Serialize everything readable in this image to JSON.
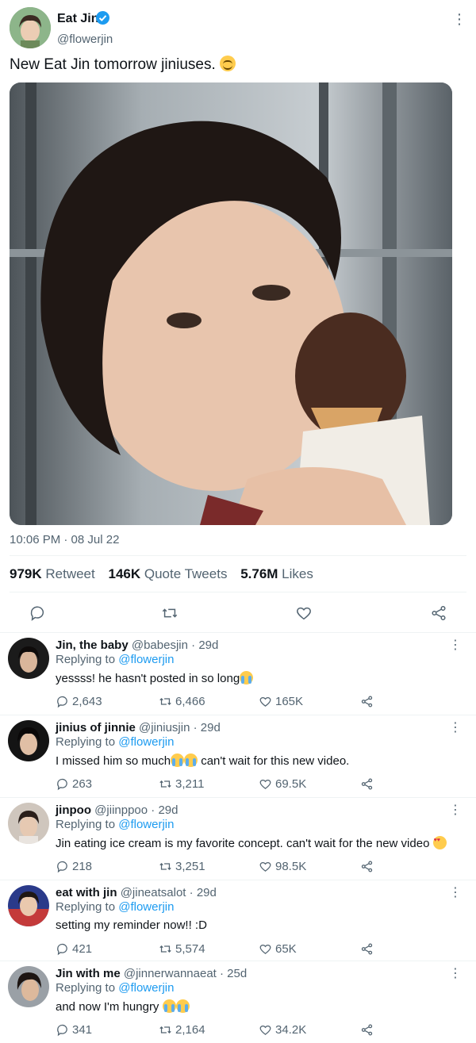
{
  "tweet": {
    "author_name": "Eat Jin",
    "author_handle": "@flowerjin",
    "verified_icon": "verified-badge-icon",
    "text": "New Eat Jin tomorrow jiniuses.",
    "text_emoji": "smiling-face-emoji",
    "media_description_icon": "photo",
    "timestamp": "10:06 PM · 08 Jul 22",
    "stats": {
      "retweets_value": "979K",
      "retweets_label": "Retweet",
      "quotes_value": "146K",
      "quotes_label": "Quote Tweets",
      "likes_value": "5.76M",
      "likes_label": "Likes"
    },
    "actions": [
      "reply-icon",
      "retweet-icon",
      "like-icon",
      "share-icon"
    ]
  },
  "replies": [
    {
      "name": "Jin, the baby",
      "handle": "@babesjin",
      "age": "29d",
      "replying_prefix": "Replying to",
      "replying_to": "@flowerjin",
      "text": "yessss! he hasn't posted in so long",
      "replies": "2,643",
      "retweets": "6,466",
      "likes": "165K"
    },
    {
      "name": "jinius of jinnie",
      "handle": "@jiniusjin",
      "age": "29d",
      "replying_prefix": "Replying to",
      "replying_to": "@flowerjin",
      "text_before": "I missed him so much",
      "text_after": " can't wait for this new video.",
      "replies": "263",
      "retweets": "3,211",
      "likes": "69.5K"
    },
    {
      "name": "jinpoo",
      "handle": "@jiinppoo",
      "age": "29d",
      "replying_prefix": "Replying to",
      "replying_to": "@flowerjin",
      "text": "Jin eating ice cream is my favorite concept. can't wait for the new video",
      "replies": "218",
      "retweets": "3,251",
      "likes": "98.5K"
    },
    {
      "name": "eat with jin",
      "handle": "@jineatsalot",
      "age": "29d",
      "replying_prefix": "Replying to",
      "replying_to": "@flowerjin",
      "text": "setting my reminder now!! :D",
      "replies": "421",
      "retweets": "5,574",
      "likes": "65K"
    },
    {
      "name": "Jin with me",
      "handle": "@jinnerwannaeat",
      "age": "25d",
      "replying_prefix": "Replying to",
      "replying_to": "@flowerjin",
      "text": "and now I'm hungry",
      "replies": "341",
      "retweets": "2,164",
      "likes": "34.2K"
    }
  ],
  "colors": {
    "text_primary": "#0f1419",
    "text_secondary": "#536471",
    "link": "#1d9bf0",
    "divider": "#eff3f4"
  }
}
